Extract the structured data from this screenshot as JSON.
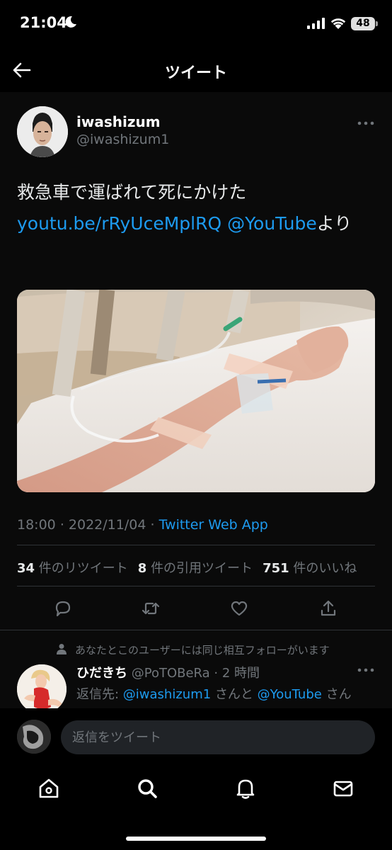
{
  "status_bar": {
    "time": "21:04",
    "battery": "48"
  },
  "header": {
    "title": "ツイート"
  },
  "tweet": {
    "author_name": "iwashizum",
    "author_handle": "@iwashizum1",
    "text_line1": "救急車で運ばれて死にかけた",
    "link_text": "youtu.be/rRyUceMplRQ",
    "mention_text": "@YouTube",
    "suffix": "より",
    "time": "18:00",
    "dot": "·",
    "date": "2022/11/04",
    "source": "Twitter Web App"
  },
  "stats": {
    "retweets_count": "34",
    "retweets_label": "件のリツイート",
    "quotes_count": "8",
    "quotes_label": "件の引用ツイート",
    "likes_count": "751",
    "likes_label": "件のいいね"
  },
  "reply": {
    "social_context": "あなたとこのユーザーには同じ相互フォローがいます",
    "name": "ひだきち",
    "handle_time": "@PoTOBeRa · 2 時間",
    "reply_prefix": "返信先: ",
    "mention1": "@iwashizum1",
    "and_text": " さんと ",
    "mention2": "@YouTube",
    "suffix": " さん"
  },
  "composer": {
    "placeholder": "返信をツイート"
  },
  "colors": {
    "accent": "#1d9bf0",
    "muted": "#71767b",
    "background": "#000000"
  }
}
